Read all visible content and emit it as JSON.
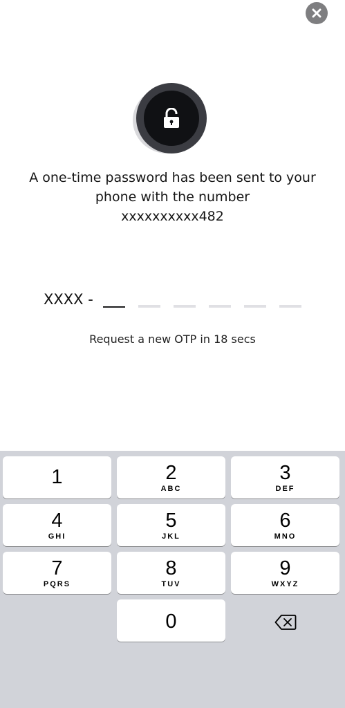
{
  "dialog": {
    "close_icon": "close-icon"
  },
  "lock_icon": "lock-icon",
  "message": {
    "line1": "A one-time password has been sent to your",
    "line2": "phone with the number",
    "line3": "xxxxxxxxxx482"
  },
  "otp": {
    "prefix": "XXXX -",
    "slot_count": 6,
    "active_slot": 0
  },
  "resend": {
    "text": "Request a new OTP in 18 secs"
  },
  "keypad": {
    "keys": [
      {
        "digit": "1",
        "letters": ""
      },
      {
        "digit": "2",
        "letters": "ABC"
      },
      {
        "digit": "3",
        "letters": "DEF"
      },
      {
        "digit": "4",
        "letters": "GHI"
      },
      {
        "digit": "5",
        "letters": "JKL"
      },
      {
        "digit": "6",
        "letters": "MNO"
      },
      {
        "digit": "7",
        "letters": "PQRS"
      },
      {
        "digit": "8",
        "letters": "TUV"
      },
      {
        "digit": "9",
        "letters": "WXYZ"
      },
      {
        "digit": "0",
        "letters": ""
      }
    ],
    "backspace_icon": "backspace-icon"
  },
  "colors": {
    "keyboard_bg": "#d1d3d9",
    "key_bg": "#ffffff",
    "close_bg": "#7e7e80",
    "lock_outer": "#3b3c42",
    "lock_inner": "#101114"
  }
}
